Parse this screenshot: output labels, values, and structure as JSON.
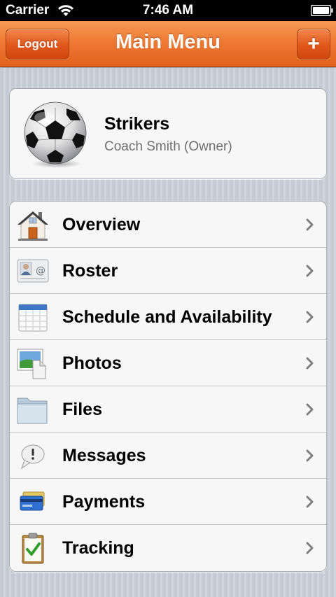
{
  "status_bar": {
    "carrier": "Carrier",
    "time": "7:46 AM"
  },
  "nav": {
    "title": "Main Menu",
    "logout_label": "Logout",
    "add_label": "+"
  },
  "team": {
    "name": "Strikers",
    "subtitle": "Coach Smith (Owner)"
  },
  "menu": {
    "items": [
      {
        "label": "Overview",
        "icon": "house-icon"
      },
      {
        "label": "Roster",
        "icon": "contact-card-icon"
      },
      {
        "label": "Schedule and Availability",
        "icon": "calendar-icon"
      },
      {
        "label": "Photos",
        "icon": "photo-icon"
      },
      {
        "label": "Files",
        "icon": "folder-icon"
      },
      {
        "label": "Messages",
        "icon": "message-bubble-icon"
      },
      {
        "label": "Payments",
        "icon": "credit-card-icon"
      },
      {
        "label": "Tracking",
        "icon": "clipboard-icon"
      }
    ]
  },
  "colors": {
    "nav_orange": "#ee7a34",
    "subtitle_gray": "#6e6e6e",
    "chevron_gray": "#7f7f7f"
  }
}
